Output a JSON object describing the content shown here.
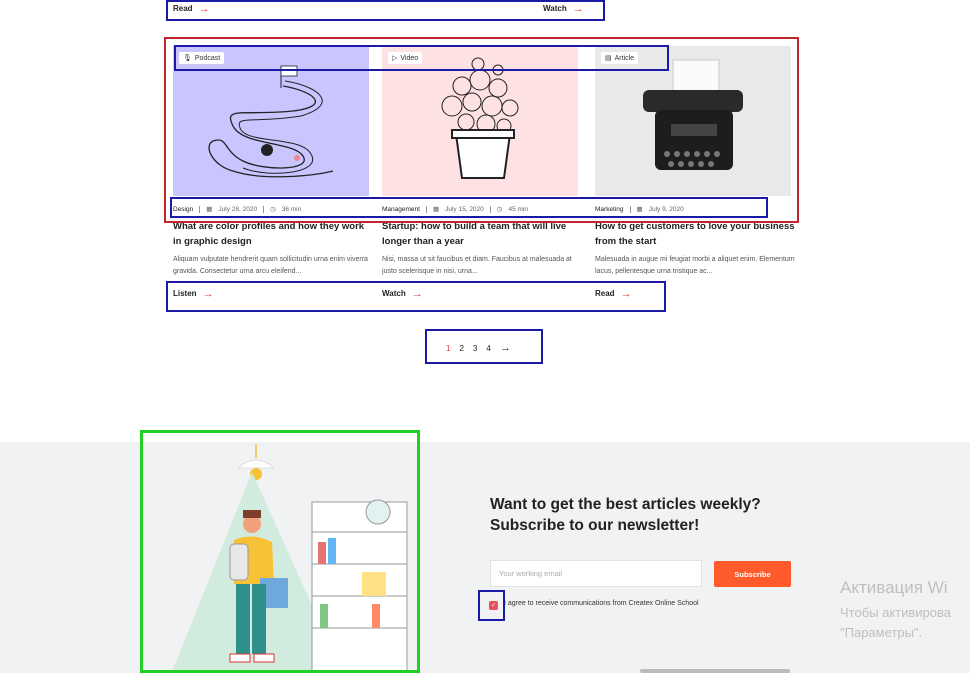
{
  "top_links": [
    {
      "label": "Read"
    },
    {
      "label": "Watch"
    }
  ],
  "cards": [
    {
      "badge": "Podcast",
      "badge_icon": "microphone-icon",
      "category": "Design",
      "date": "July 28, 2020",
      "duration": "36 min",
      "title": "What are color profiles and how they work in graphic design",
      "excerpt": "Aliquam vulputate hendrerit quam sollicitudin urna enim viverra gravida. Consectetur urna arcu eleifend...",
      "action": "Listen",
      "image_bg": "#c9c6ff"
    },
    {
      "badge": "Video",
      "badge_icon": "play-icon",
      "category": "Management",
      "date": "July 15, 2020",
      "duration": "45 min",
      "title": "Startup: how to build a team that will live longer than a year",
      "excerpt": "Nisi, massa ut sit faucibus et diam. Faucibus at malesuada at justo scelerisque in nisi, urna...",
      "action": "Watch",
      "image_bg": "#fde1e3"
    },
    {
      "badge": "Article",
      "badge_icon": "document-icon",
      "category": "Marketing",
      "date": "July 9, 2020",
      "duration": "",
      "title": "How to get customers to love your business from the start",
      "excerpt": "Malesuada in augue mi feugiat morbi a aliquet enim. Elementum lacus, pellentesque urna tristique ac...",
      "action": "Read",
      "image_bg": "#e9e9ea"
    }
  ],
  "pagination": {
    "pages": [
      "1",
      "2",
      "3",
      "4"
    ],
    "active": "1",
    "next": "→"
  },
  "newsletter": {
    "title_line1": "Want to get the best articles weekly?",
    "title_line2": "Subscribe to our newsletter!",
    "email_placeholder": "Your working email",
    "subscribe_label": "Subscribe",
    "agree_text": "I agree to receive communications from Createx Online School"
  },
  "watermark": {
    "line1": "Активация Wi",
    "line2": "Чтобы активирова",
    "line3": "\"Параметры\"."
  },
  "colors": {
    "accent": "#ff5a2c",
    "arrow": "#e53935",
    "annotation_red": "#c0262d",
    "annotation_blue": "#1a1aa6",
    "annotation_green": "#22d022"
  }
}
